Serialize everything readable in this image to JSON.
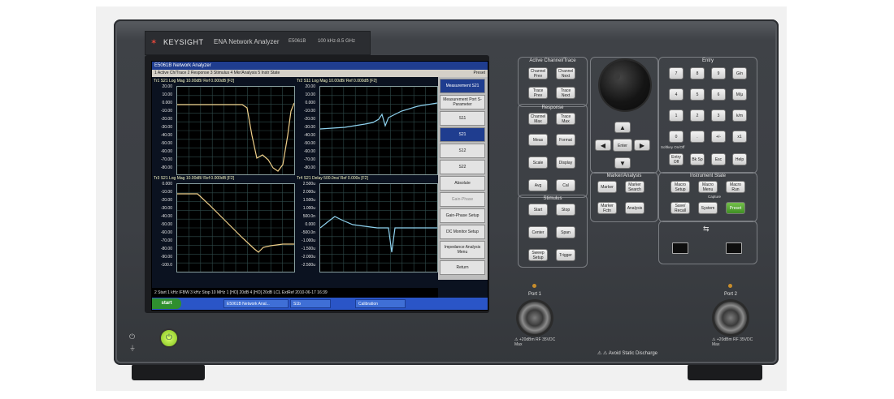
{
  "device": {
    "brand": "KEYSIGHT",
    "model_name": "ENA Network Analyzer",
    "model_number": "E5061B",
    "freq_range": "100 kHz-8.5 GHz"
  },
  "screen": {
    "app_title": "E5061B Network Analyzer",
    "menu_text": "1 Active Ch/Trace   2 Response   3 Stimulus   4 Mkr/Analysis   5 Instr State",
    "preset_mark": "Preset",
    "channels": [
      {
        "header": "Tr1  S21 Log Mag 10.00dB/ Ref 0.000dB [F2]",
        "ticks": [
          "20.00",
          "10.00",
          "0.000",
          "-10.00",
          "-20.00",
          "-30.00",
          "-40.00",
          "-50.00",
          "-60.00",
          "-70.00",
          "-80.00"
        ],
        "start": "1  Start 1 kHz",
        "stop": "Stop 1 MHz"
      },
      {
        "header": "Tr2  S11 Log Mag 10.00dB/ Ref 0.000dB [F2]",
        "ticks": [
          "20.00",
          "10.00",
          "0.000",
          "-10.00",
          "-20.00",
          "-30.00",
          "-40.00",
          "-50.00",
          "-60.00",
          "-70.00",
          "-80.00"
        ],
        "start": "IFBW 3 kHz",
        "stop": "Stop 1 GHz"
      },
      {
        "header": "Tr3  S21 Log Mag 10.00dB/ Ref 0.000dB [F2]",
        "ticks": [
          "0.000",
          "-10.00",
          "-20.00",
          "-30.00",
          "-40.00",
          "-50.00",
          "-60.00",
          "-70.00",
          "-80.00",
          "-90.00",
          "-100.0"
        ],
        "start": "2  Start 1 kHz",
        "stop": "IFBW 3 kHz"
      },
      {
        "header": "Tr4  S21 Delay 500.0ns/ Ref 0.000s [F2]",
        "ticks": [
          "2.500u",
          "2.000u",
          "1.500u",
          "1.000u",
          "500.0n",
          "0.000",
          "-500.0n",
          "-1.000u",
          "-1.500u",
          "-2.000u",
          "-2.500u"
        ],
        "start": "",
        "stop": "Stop 10 MHz"
      }
    ],
    "softkeys": [
      {
        "label": "Measurement S21",
        "selected": true
      },
      {
        "label": "Measurement Port S-Parameter",
        "selected": false
      },
      {
        "label": "S11",
        "selected": false
      },
      {
        "label": "S21",
        "selected": true
      },
      {
        "label": "S12",
        "selected": false
      },
      {
        "label": "S22",
        "selected": false
      },
      {
        "label": "Absolute",
        "selected": false
      },
      {
        "label": "Gain-Phase",
        "selected": false
      },
      {
        "label": "Gain-Phase Setup",
        "selected": false
      },
      {
        "label": "DC Monitor Setup",
        "selected": false
      },
      {
        "label": "Impedance Analysis Menu",
        "selected": false
      },
      {
        "label": "Return",
        "selected": false
      }
    ],
    "status_bar": "2  Start 1 kHz        IFBW 3 kHz      Stop 10 MHz    1 [HO] 20dB 4 [HO] 20dB  LCL  ExtRef  2010-06-17 16:39",
    "taskbar": {
      "start": "start",
      "tasks": [
        "E5061B Network Anal...",
        "S1b",
        "Calibration"
      ]
    }
  },
  "panel": {
    "active_channel": {
      "title": "Active Channel/Trace",
      "keys": [
        "Channel Prev",
        "Channel Next",
        "Trace Prev",
        "Trace Next"
      ]
    },
    "response": {
      "title": "Response",
      "keys": [
        "Channel Max",
        "Trace Max",
        "Meas",
        "Format",
        "Scale",
        "Display",
        "Avg",
        "Cal"
      ]
    },
    "stimulus": {
      "title": "Stimulus",
      "keys": [
        "Start",
        "Stop",
        "Center",
        "Span",
        "Sweep Setup",
        "Trigger"
      ]
    },
    "entry": {
      "title": "Entry",
      "keys": [
        "7",
        "8",
        "9",
        "G/n",
        "4",
        "5",
        "6",
        "M/μ",
        "1",
        "2",
        "3",
        "k/m",
        "0",
        ".",
        "+/-",
        "x1",
        "Entry Off",
        "Bk Sp",
        "Esc",
        "Help"
      ],
      "caption": "Softkey On/Off"
    },
    "marker": {
      "title": "Marker/Analysis",
      "keys": [
        "Marker",
        "Marker Search",
        "Marker Fctn",
        "Analysis"
      ]
    },
    "instrument": {
      "title": "Instrument State",
      "keys": [
        "Macro Setup",
        "Macro Menu",
        "Macro Run",
        "Save/ Recall",
        "System",
        "Preset"
      ],
      "capture": "Capture"
    },
    "nav": {
      "up": "▲",
      "down": "▼",
      "left": "◀",
      "right": "▶",
      "enter": "Enter"
    }
  },
  "ports": {
    "port1": {
      "label": "Port 1",
      "spec": "⚠ +20dBm RF  35VDC Max"
    },
    "port2": {
      "label": "Port 2",
      "spec": "⚠ +20dBm RF  35VDC Max"
    },
    "esd": "⚠ ⚠ Avoid Static Discharge"
  },
  "colors": {
    "trace": "#f0d08a",
    "trace_blue": "#8fd3f0",
    "grid": "#2f4b4b",
    "preset_key": "#5aa832"
  }
}
